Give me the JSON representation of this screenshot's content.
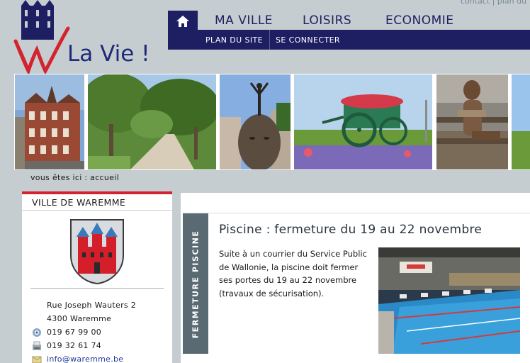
{
  "header": {
    "top_links": [
      "contact",
      "plan du"
    ],
    "top_sep": "|",
    "logo_text": "La Vie !"
  },
  "nav": {
    "home_icon": "home-icon",
    "items": [
      "MA VILLE",
      "LOISIRS",
      "ECONOMIE"
    ],
    "sub_items": [
      "PLAN DU SITE",
      "SE CONNECTER"
    ]
  },
  "breadcrumb": "vous êtes ici : accueil",
  "sidebar": {
    "title": "VILLE DE WAREMME",
    "address_line1": "Rue Joseph Wauters 2",
    "address_line2": "4300 Waremme",
    "phone": "019 67 99 00",
    "fax": "019 32 61 74",
    "email": "info@waremme.be"
  },
  "article": {
    "tab_label": "FERMETURE PISCINE",
    "title": "Piscine : fermeture du 19 au 22 novembre",
    "body": "Suite à un courrier du Service Public de Wallonie, la piscine doit fermer ses portes du 19 au 22 novembre (travaux de sécurisation)."
  },
  "colors": {
    "navy": "#1e1f62",
    "accent_red": "#d4232f",
    "background": "#c5cdd0"
  }
}
